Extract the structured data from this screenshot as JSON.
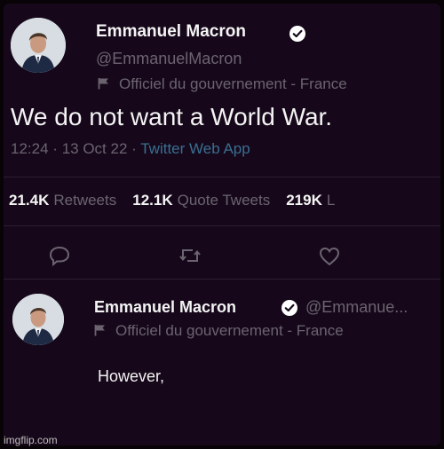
{
  "tweet": {
    "author_name": "Emmanuel Macron",
    "author_handle": "@EmmanuelMacron",
    "official_label": "Officiel du gouvernement - France",
    "text": "We do not want a World War.",
    "time": "12:24",
    "date": "13 Oct 22",
    "separator": "·",
    "source": "Twitter Web App",
    "stats": [
      {
        "value": "21.4K",
        "label": "Retweets"
      },
      {
        "value": "12.1K",
        "label": "Quote Tweets"
      },
      {
        "value": "219K",
        "label": "L"
      }
    ],
    "actions": [
      "reply-icon",
      "retweet-icon",
      "like-icon"
    ]
  },
  "reply": {
    "author_name": "Emmanuel Macron",
    "author_handle": "@Emmanue...",
    "official_label": "Officiel du gouvernement - France",
    "text": "However,"
  },
  "watermark": "imgflip.com",
  "colors": {
    "background": "#16081a",
    "muted_text": "#6b6470",
    "link": "#3a6f91",
    "verified_badge": "#ffffff"
  }
}
